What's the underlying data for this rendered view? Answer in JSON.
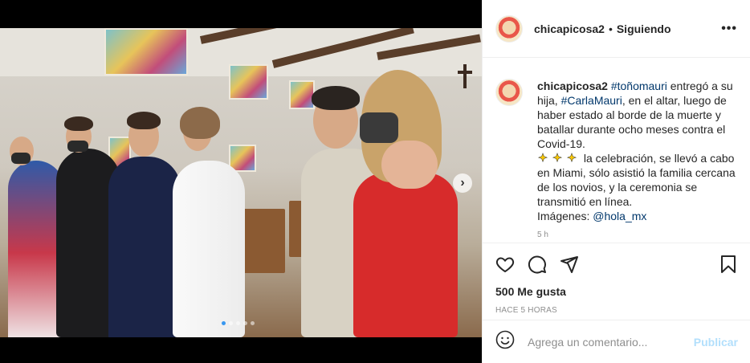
{
  "post": {
    "username": "chicapicosa2",
    "separator": "•",
    "follow_status": "Siguiendo",
    "more_label": "•••"
  },
  "caption": {
    "username": "chicapicosa2",
    "hashtag_1": "#toñomauri",
    "text_1": " entregó a su hija, ",
    "hashtag_2": "#CarlaMauri",
    "text_2": ", en el altar, luego de haber estado al borde de la muerte y batallar durante ocho meses contra el Covid-19.",
    "text_3": " la celebración, se llevó a cabo en Miami, sólo asistió la familia cercana de los novios, y la ceremonia se transmitió en línea.",
    "images_label": "Imágenes: ",
    "mention": "@hola_mx",
    "emoji_icon": "sparkles-icon",
    "time_small": "5 h"
  },
  "actions": {
    "likes": "500 Me gusta",
    "time": "HACE 5 HORAS"
  },
  "comment": {
    "placeholder": "Agrega un comentario...",
    "publish_label": "Publicar"
  },
  "carousel": {
    "next_icon": "chevron-right-icon",
    "current_slide": 1,
    "slide_count": 5
  },
  "colors": {
    "link": "#00376b",
    "publish_disabled": "#b2dffc",
    "active_dot": "#3897f0"
  }
}
